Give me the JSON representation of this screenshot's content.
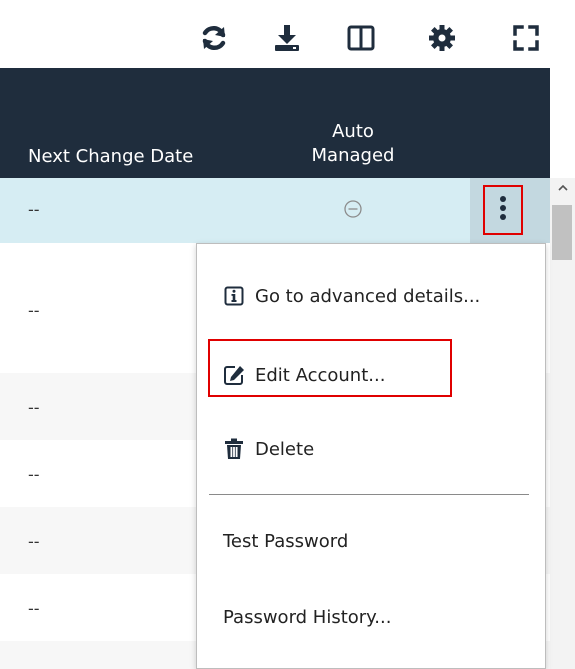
{
  "toolbar": {
    "icons": [
      "refresh-icon",
      "download-icon",
      "columns-icon",
      "gear-icon",
      "fullscreen-icon"
    ]
  },
  "table": {
    "headers": {
      "next_change_date": "Next Change Date",
      "auto_managed_line1": "Auto",
      "auto_managed_line2": "Managed"
    },
    "rows": [
      {
        "next_change_date": "--",
        "auto_managed_icon": "minus-circle-icon"
      },
      {
        "next_change_date": "--"
      },
      {
        "next_change_date": "--"
      },
      {
        "next_change_date": "--"
      },
      {
        "next_change_date": "--"
      },
      {
        "next_change_date": "--"
      }
    ]
  },
  "context_menu": {
    "items": [
      {
        "label": "Go to advanced details...",
        "icon": "info-icon"
      },
      {
        "label": "Edit Account...",
        "icon": "edit-icon"
      },
      {
        "label": "Delete",
        "icon": "trash-icon"
      },
      {
        "label": "Test Password"
      },
      {
        "label": "Password History..."
      }
    ]
  },
  "colors": {
    "header_bg": "#1f2d3d",
    "selected_row_bg": "#d6edf3",
    "stripe_bg": "#f7f7f7",
    "highlight_border": "#e00000"
  }
}
